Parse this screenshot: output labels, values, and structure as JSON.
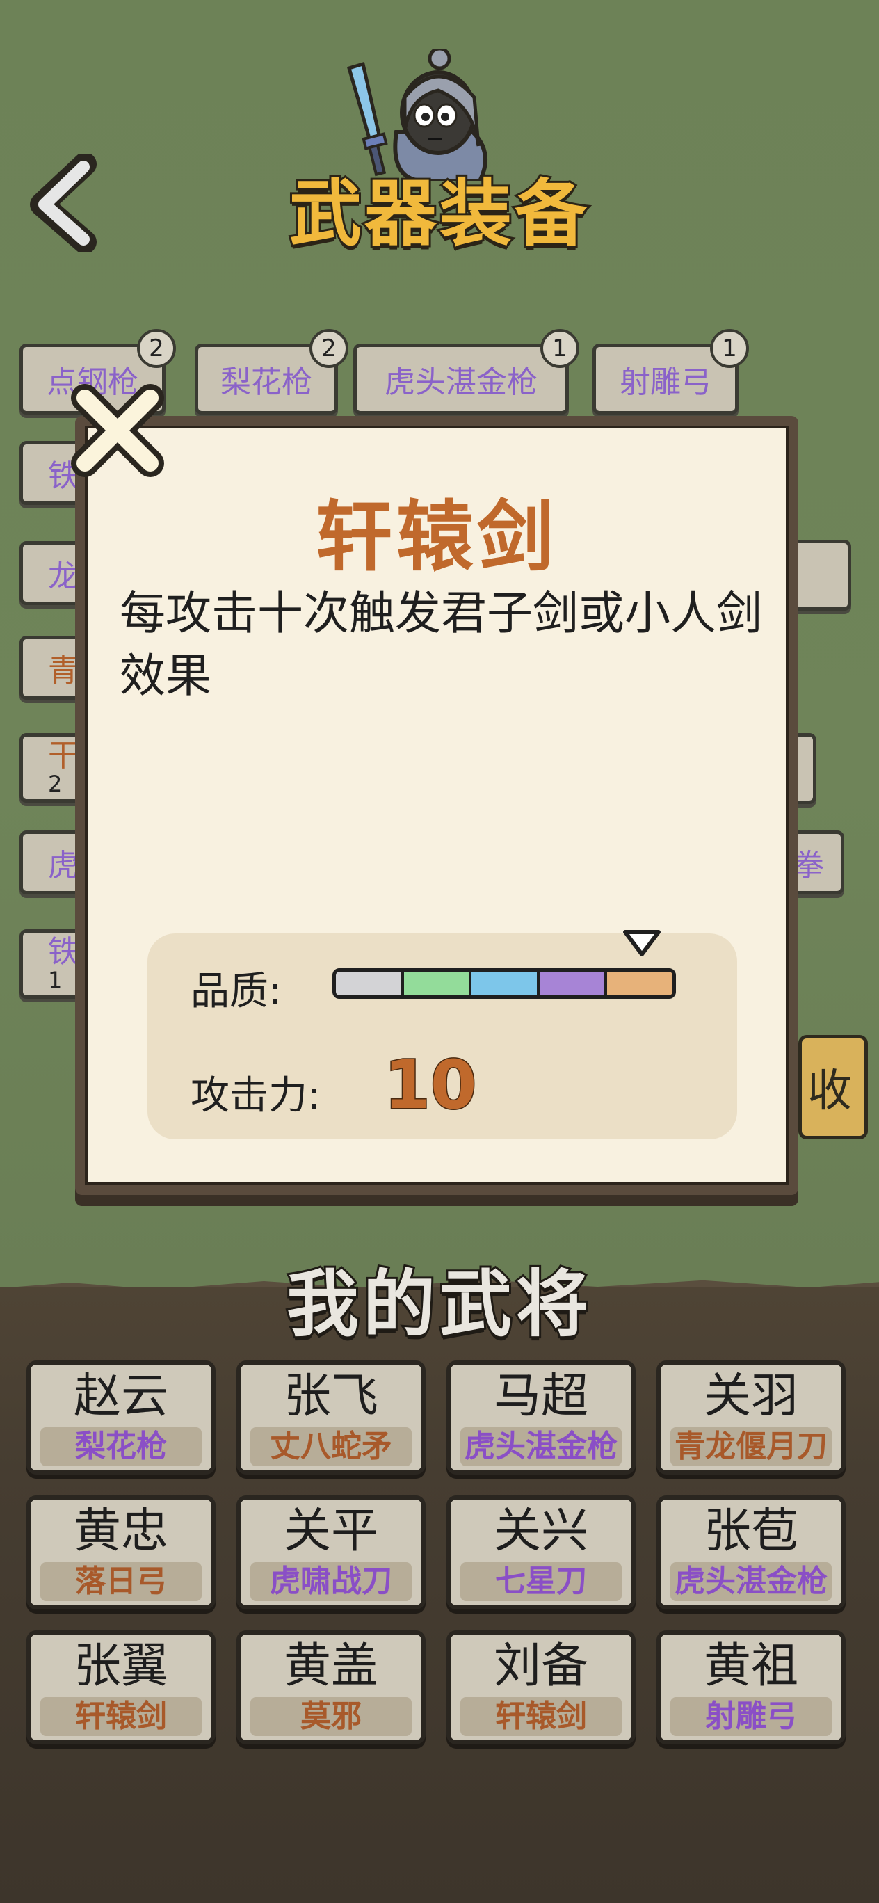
{
  "header": {
    "title": "武器装备"
  },
  "weapon_chips": [
    {
      "label": "点钢枪",
      "count": "2"
    },
    {
      "label": "梨花枪",
      "count": "2"
    },
    {
      "label": "虎头湛金枪",
      "count": "1"
    },
    {
      "label": "射雕弓",
      "count": "1"
    },
    {
      "label": "铁"
    },
    {
      "label": "龙"
    },
    {
      "label": "青"
    },
    {
      "label": "干",
      "sub": "2"
    },
    {
      "label": "虎"
    },
    {
      "label": "拳"
    },
    {
      "label": "铁",
      "sub": "1"
    }
  ],
  "side_button": {
    "label": "收"
  },
  "modal": {
    "weapon_name": "轩辕剑",
    "description": "每攻击十次触发君子剑或小人剑效果",
    "quality_label": "品质:",
    "quality_level": 5,
    "quality_colors": [
      "#d3d3d6",
      "#93dc9a",
      "#7dc6ea",
      "#a784d6",
      "#e7b27a"
    ],
    "attack_label": "攻击力:",
    "attack_value": "10"
  },
  "generals_section": {
    "title": "我的武将",
    "generals": [
      {
        "name": "赵云",
        "weapon": "梨花枪",
        "weapon_color": "purple"
      },
      {
        "name": "张飞",
        "weapon": "丈八蛇矛",
        "weapon_color": "brown"
      },
      {
        "name": "马超",
        "weapon": "虎头湛金枪",
        "weapon_color": "purple"
      },
      {
        "name": "关羽",
        "weapon": "青龙偃月刀",
        "weapon_color": "brown"
      },
      {
        "name": "黄忠",
        "weapon": "落日弓",
        "weapon_color": "brown"
      },
      {
        "name": "关平",
        "weapon": "虎啸战刀",
        "weapon_color": "purple"
      },
      {
        "name": "关兴",
        "weapon": "七星刀",
        "weapon_color": "purple"
      },
      {
        "name": "张苞",
        "weapon": "虎头湛金枪",
        "weapon_color": "purple"
      },
      {
        "name": "张翼",
        "weapon": "轩辕剑",
        "weapon_color": "brown"
      },
      {
        "name": "黄盖",
        "weapon": "莫邪",
        "weapon_color": "brown"
      },
      {
        "name": "刘备",
        "weapon": "轩辕剑",
        "weapon_color": "brown"
      },
      {
        "name": "黄祖",
        "weapon": "射雕弓",
        "weapon_color": "purple"
      }
    ]
  }
}
